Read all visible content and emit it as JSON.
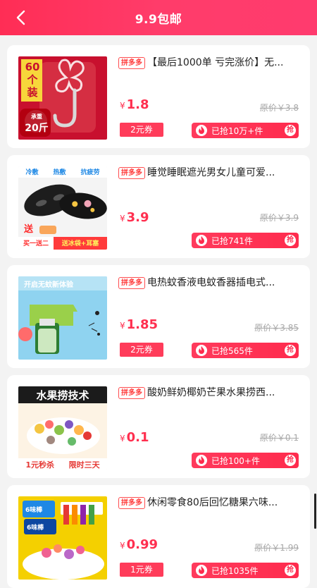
{
  "header": {
    "title": "9.9包邮"
  },
  "colors": {
    "accent": "#ff2d55",
    "price": "#ff2f4f"
  },
  "products": [
    {
      "tag": "拼多多",
      "title": "【最后1000单 亏完涨价】无...",
      "currency": "¥",
      "price": "1.8",
      "original": "原价￥3.8",
      "coupon": "2元券",
      "sold": "已抢10万+件",
      "grab": "抢",
      "thumb_lines": [
        "60",
        "个",
        "装",
        "承重",
        "20斤"
      ]
    },
    {
      "tag": "拼多多",
      "title": "睡觉睡眠遮光男女儿童可爱...",
      "currency": "¥",
      "price": "3.9",
      "original": "原价￥3.9",
      "coupon": "",
      "sold": "已抢741件",
      "grab": "抢",
      "thumb_lines": [
        "冷敷",
        "热敷",
        "抗疲劳",
        "送",
        "买一送二",
        "送冰袋+耳塞"
      ]
    },
    {
      "tag": "拼多多",
      "title": "电热蚊香液电蚊香器插电式...",
      "currency": "¥",
      "price": "1.85",
      "original": "原价￥3.85",
      "coupon": "2元券",
      "sold": "已抢565件",
      "grab": "抢",
      "thumb_lines": [
        "开启无蚊新体验"
      ]
    },
    {
      "tag": "拼多多",
      "title": "酸奶鲜奶椰奶芒果水果捞西...",
      "currency": "¥",
      "price": "0.1",
      "original": "原价￥0.1",
      "coupon": "",
      "sold": "已抢100+件",
      "grab": "抢",
      "thumb_lines": [
        "水果捞技术",
        "1元秒杀",
        "限时三天"
      ]
    },
    {
      "tag": "拼多多",
      "title": "休闲零食80后回忆糖果六味...",
      "currency": "¥",
      "price": "0.99",
      "original": "原价￥1.99",
      "coupon": "1元券",
      "sold": "已抢1035件",
      "grab": "抢",
      "thumb_lines": [
        "6味棒",
        "6味棒"
      ]
    }
  ]
}
